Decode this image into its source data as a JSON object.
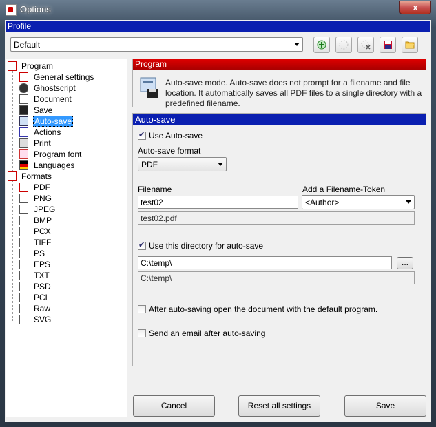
{
  "window": {
    "title": "Options",
    "close_label": "x"
  },
  "profile": {
    "header": "Profile",
    "selected": "Default"
  },
  "toolbar_icons": [
    "add-profile-icon",
    "rename-profile-icon",
    "delete-profile-icon",
    "save-profile-icon",
    "open-profile-icon"
  ],
  "tree": {
    "program": "Program",
    "program_items": [
      "General settings",
      "Ghostscript",
      "Document",
      "Save",
      "Auto-save",
      "Actions",
      "Print",
      "Program font",
      "Languages"
    ],
    "selected": "Auto-save",
    "formats": "Formats",
    "format_items": [
      "PDF",
      "PNG",
      "JPEG",
      "BMP",
      "PCX",
      "TIFF",
      "PS",
      "EPS",
      "TXT",
      "PSD",
      "PCL",
      "Raw",
      "SVG"
    ]
  },
  "program_section": {
    "header": "Program",
    "description": "Auto-save mode. Auto-save does not prompt for a filename and file location. It automatically saves all PDF files to a single directory with a predefined filename."
  },
  "autosave": {
    "header": "Auto-save",
    "use_autosave_label": "Use Auto-save",
    "use_autosave_checked": true,
    "format_label": "Auto-save format",
    "format_value": "PDF",
    "filename_label": "Filename",
    "filename_value": "test02",
    "token_label": "Add a Filename-Token",
    "token_value": "<Author>",
    "filename_preview": "test02.pdf",
    "use_dir_label": "Use this directory for auto-save",
    "use_dir_checked": true,
    "dir_value": "C:\\temp\\",
    "browse_label": "...",
    "dir_preview": "C:\\temp\\",
    "open_after_label": "After auto-saving open the document with the default program.",
    "open_after_checked": false,
    "send_email_label": "Send an email after auto-saving",
    "send_email_checked": false
  },
  "buttons": {
    "cancel": "Cancel",
    "reset": "Reset all settings",
    "save": "Save"
  },
  "colors": {
    "profile_bar": "#0a1fb0",
    "program_bar": "#c00000",
    "selection": "#3399ff"
  }
}
